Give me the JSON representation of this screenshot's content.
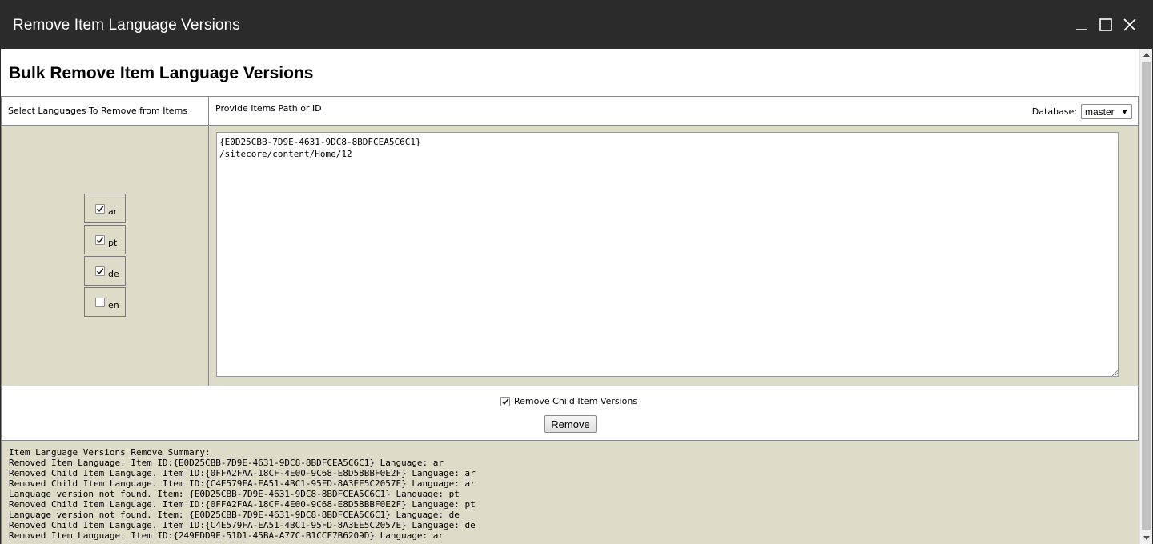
{
  "window": {
    "title": "Remove Item Language Versions",
    "controls": [
      "minimize-icon",
      "maximize-icon",
      "close-icon"
    ]
  },
  "page": {
    "heading": "Bulk Remove Item Language Versions"
  },
  "languages_panel": {
    "header": "Select Languages To Remove from Items",
    "languages": [
      {
        "code": "ar",
        "checked": true
      },
      {
        "code": "pt",
        "checked": true
      },
      {
        "code": "de",
        "checked": true
      },
      {
        "code": "en",
        "checked": false
      }
    ]
  },
  "items_panel": {
    "header": "Provide Items Path or ID",
    "database_label": "Database:",
    "database_value": "master",
    "items_text": "{E0D25CBB-7D9E-4631-9DC8-8BDFCEA5C6C1}\n/sitecore/content/Home/12"
  },
  "options": {
    "remove_child_label": "Remove Child Item Versions",
    "remove_child_checked": true,
    "remove_button": "Remove"
  },
  "summary": {
    "lines": [
      "Item Language Versions Remove Summary:",
      "Removed Item Language. Item ID:{E0D25CBB-7D9E-4631-9DC8-8BDFCEA5C6C1} Language: ar",
      "Removed Child Item Language. Item ID:{0FFA2FAA-18CF-4E00-9C68-E8D58BBF0E2F} Language: ar",
      "Removed Child Item Language. Item ID:{C4E579FA-EA51-4BC1-95FD-8A3EE5C2057E} Language: ar",
      "Language version not found. Item: {E0D25CBB-7D9E-4631-9DC8-8BDFCEA5C6C1} Language: pt",
      "Removed Child Item Language. Item ID:{0FFA2FAA-18CF-4E00-9C68-E8D58BBF0E2F} Language: pt",
      "Language version not found. Item: {E0D25CBB-7D9E-4631-9DC8-8BDFCEA5C6C1} Language: de",
      "Removed Child Item Language. Item ID:{C4E579FA-EA51-4BC1-95FD-8A3EE5C2057E} Language: de",
      "Removed Item Language. Item ID:{249FDD9E-51D1-45BA-A77C-B1CCF7B6209D} Language: ar"
    ]
  },
  "colors": {
    "titlebar_bg": "#2b2b2b",
    "panel_bg": "#dcdcc8",
    "border": "#8a8a8a"
  }
}
